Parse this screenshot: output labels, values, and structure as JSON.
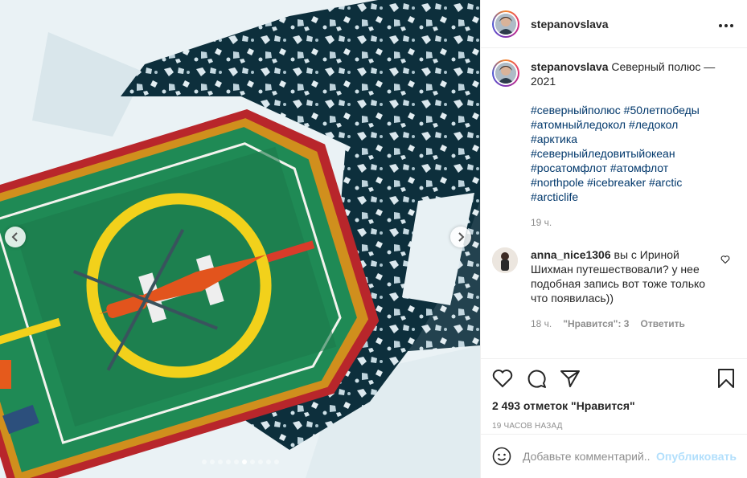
{
  "post": {
    "username": "stepanovslava",
    "more_icon": "more-horizontal-icon",
    "carousel": {
      "total": 10,
      "active": 6
    }
  },
  "caption": {
    "username": "stepanovslava",
    "text": "Северный полюс — 2021",
    "hashtags": [
      "#северныйполюс",
      "#50летпобеды",
      "#атомныйледокол",
      "#ледокол",
      "#арктика",
      "#северныйледовитыйокеан",
      "#росатомфлот",
      "#атомфлот",
      "#northpole",
      "#icebreaker",
      "#arctic",
      "#arcticlife"
    ],
    "time": "19 ч."
  },
  "comment": {
    "username": "anna_nice1306",
    "text": "вы с Ириной Шихман путешествовали? у нее подобная запись вот тоже только что появилась))",
    "time": "18 ч.",
    "likes": "\"Нравится\": 3",
    "reply": "Ответить"
  },
  "actions": {
    "likes": "2 493 отметок \"Нравится\"",
    "posted": "19 часов назад"
  },
  "add_comment": {
    "placeholder": "Добавьте комментарий...",
    "publish": "Опубликовать"
  },
  "colors": {
    "link": "#00376b",
    "muted": "#8e8e8e",
    "publish": "#b2dffc"
  }
}
